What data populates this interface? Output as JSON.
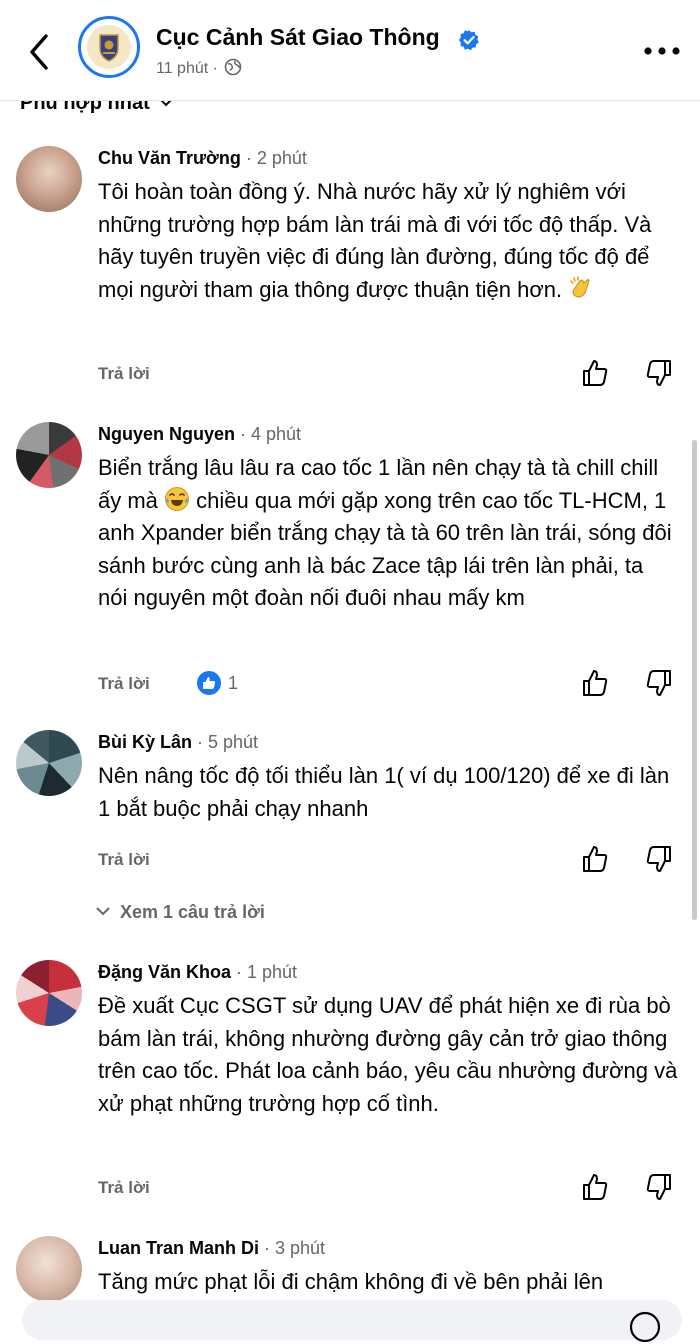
{
  "header": {
    "page_name": "Cục Cảnh Sát Giao Thông",
    "post_time": "11 phút ·",
    "icons": [
      "back-arrow-icon",
      "page-logo",
      "verified-badge-icon",
      "globe-icon",
      "more-icon"
    ]
  },
  "sort": {
    "label": "Phù hợp nhất"
  },
  "comments": [
    {
      "author": "Chu Văn Trường",
      "time": " · 2 phút",
      "text": "Tôi hoàn toàn đồng ý. Nhà nước hãy xử lý nghiêm với những trường hợp bám làn trái mà đi với tốc độ thấp. Và hãy tuyên truyền việc đi đúng làn đường, đúng tốc độ để mọi người tham gia thông được thuận tiện hơn. ",
      "emoji": "clapping-hands",
      "reply_label": "Trả lời"
    },
    {
      "author": "Nguyen Nguyen",
      "time": " · 4 phút",
      "text_before_emoji": "Biển trắng lâu lâu ra cao tốc 1 lần nên chạy tà tà chill chill ấy mà ",
      "text_after_emoji": " chiều qua mới gặp xong trên cao tốc TL-HCM, 1 anh Xpander biển trắng chạy tà tà 60 trên làn trái, sóng đôi sánh bước cùng anh là bác Zace tập lái trên làn phải, ta nói nguyên một đoàn nối đuôi nhau mấy km",
      "emoji": "laughing-tears",
      "reply_label": "Trả lời",
      "like_count": "1"
    },
    {
      "author": "Bùi Kỳ Lân",
      "time": " · 5 phút",
      "text": "Nên nâng tốc độ tối thiểu làn 1( ví dụ 100/120) để xe đi làn 1 bắt buộc phải chạy nhanh",
      "reply_label": "Trả lời",
      "view_replies": "Xem 1 câu trả lời"
    },
    {
      "author": "Đặng Văn Khoa",
      "time": " · 1 phút",
      "text": "Đề xuất Cục CSGT sử dụng UAV để phát hiện xe đi rùa bò bám làn trái, không nhường đường  gây cản trở giao thông trên cao tốc. Phát loa cảnh báo, yêu cầu nhường đường và xử phạt những trường hợp cố tình.",
      "reply_label": "Trả lời"
    },
    {
      "author": "Luan Tran Manh Di",
      "time": " · 3 phút",
      "text": "Tăng mức phạt lỗi đi chậm không đi về bên phải lên"
    }
  ],
  "colors": {
    "text": "#050505",
    "secondary": "#65676b",
    "accent": "#1877f2",
    "divider": "#e4e6eb"
  }
}
